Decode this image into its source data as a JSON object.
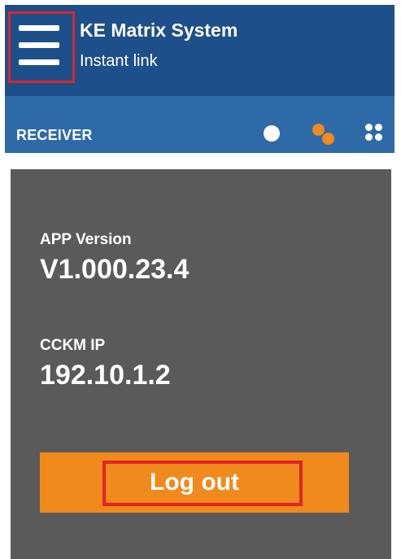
{
  "header": {
    "title": "KE Matrix System",
    "subtitle": "Instant link",
    "menu_icon": "hamburger-menu-icon"
  },
  "tab_bar": {
    "active_tab": "RECEIVER",
    "icons": [
      "single-dot-icon",
      "two-dots-icon",
      "four-dots-grid-icon"
    ]
  },
  "info": {
    "app_version_label": "APP Version",
    "app_version_value": "V1.000.23.4",
    "ip_label": "CCKM IP",
    "ip_value": "192.10.1.2"
  },
  "actions": {
    "logout_label": "Log out"
  },
  "colors": {
    "header_top": "#1d4f8a",
    "header_tabs": "#2e6aa8",
    "panel": "#5a5a5a",
    "accent": "#f08a1c",
    "highlight": "#e0242a"
  }
}
